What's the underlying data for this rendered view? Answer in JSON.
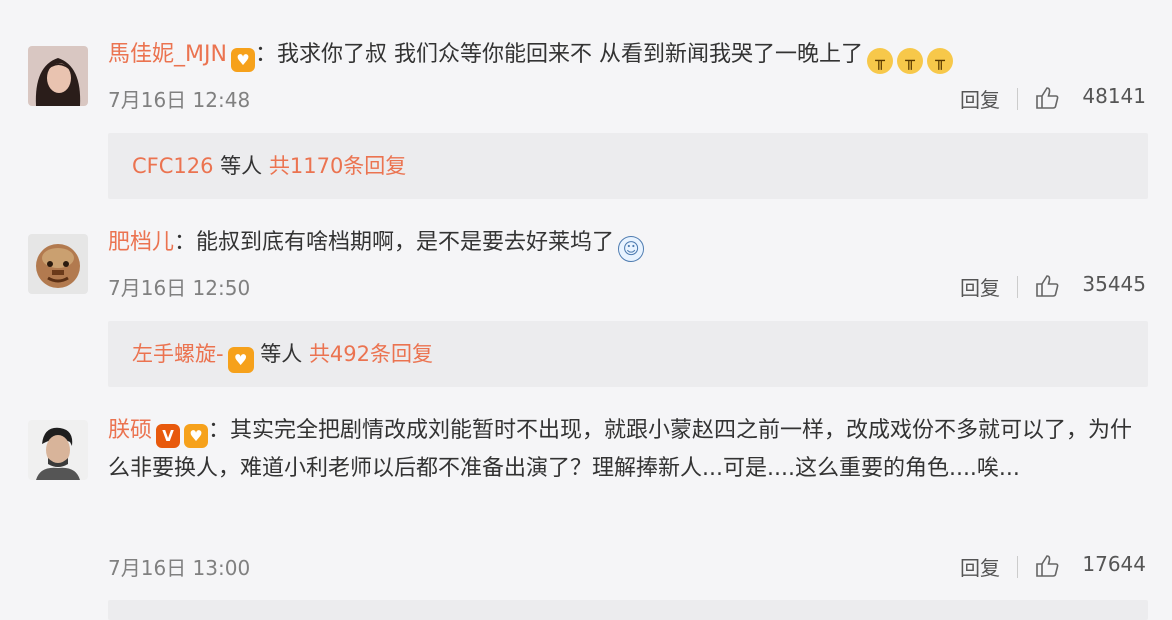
{
  "comments": [
    {
      "username": "馬佳妮_MJN",
      "colon": "：",
      "text": "我求你了叔 我们众等你能回来不 从看到新闻我哭了一晚上了",
      "emoji_count": 3,
      "time": "7月16日 12:48",
      "reply_label": "回复",
      "likes": "48141",
      "reply_summary": {
        "name": "CFC126",
        "mid": " 等人 ",
        "total": "共1170条回复"
      }
    },
    {
      "username": "肥档儿",
      "colon": "：",
      "text": "能叔到底有啥档期啊，是不是要去好莱坞了",
      "time": "7月16日 12:50",
      "reply_label": "回复",
      "likes": "35445",
      "reply_summary": {
        "name": "左手螺旋-",
        "mid": " 等人 ",
        "total": "共492条回复"
      }
    },
    {
      "username": "朕硕",
      "colon": "：",
      "text": "其实完全把剧情改成刘能暂时不出现，就跟小蒙赵四之前一样，改成戏份不多就可以了，为什么非要换人，难道小利老师以后都不准备出演了？理解捧新人...可是....这么重要的角色....唉...",
      "time": "7月16日 13:00",
      "reply_label": "回复",
      "likes": "17644"
    }
  ],
  "icons": {
    "like": "thumbs-up-icon",
    "fan_badge": "fan-badge-icon",
    "vip_badge": "vip-v-icon",
    "cry_emoji": "crying-face-icon",
    "doge_emoji": "doge-face-icon"
  },
  "colors": {
    "username": "#eb7350",
    "meta": "#808080",
    "background": "#f5f5f7",
    "reply_box": "#ececee"
  }
}
